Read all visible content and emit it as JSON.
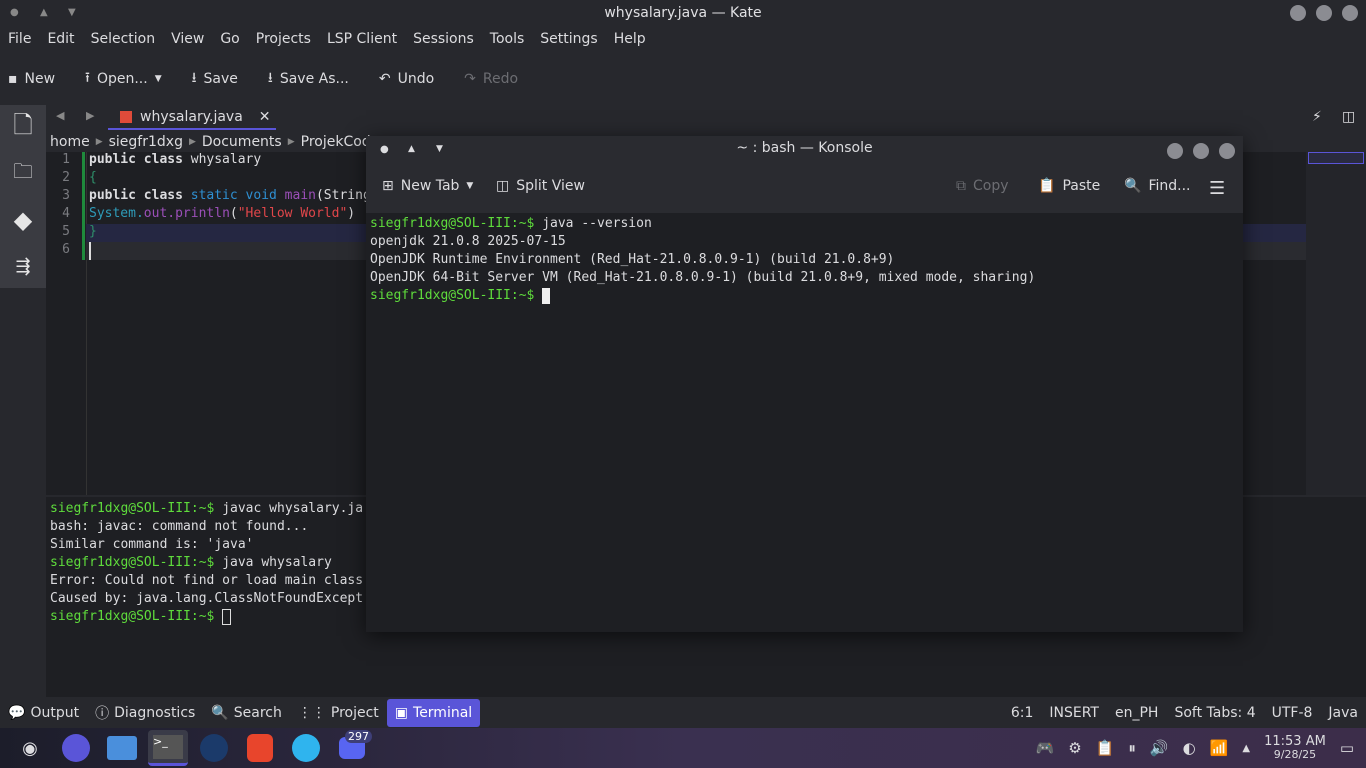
{
  "window": {
    "title": "whysalary.java — Kate"
  },
  "menu": [
    "File",
    "Edit",
    "Selection",
    "View",
    "Go",
    "Projects",
    "LSP Client",
    "Sessions",
    "Tools",
    "Settings",
    "Help"
  ],
  "toolbar": {
    "new": "New",
    "open": "Open...",
    "save": "Save",
    "save_as": "Save As...",
    "undo": "Undo",
    "redo": "Redo"
  },
  "tab": {
    "label": "whysalary.java"
  },
  "breadcrumb": [
    "home",
    "siegfr1dxg",
    "Documents",
    "ProjekCods"
  ],
  "code": {
    "lines": [
      "1",
      "2",
      "3",
      "4",
      "5",
      "6"
    ],
    "l1a": "public class",
    "l1b": " whysalary",
    "l2": "{",
    "l3a": "public class",
    "l3b": " static void ",
    "l3c": "main",
    "l3d": "(String",
    "l4a": "System.",
    "l4b": "out.println",
    "l4c": "(",
    "l4d": "\"Hellow World\"",
    "l4e": ")",
    "l5": "}"
  },
  "bottom_terminal": [
    {
      "prompt": "siegfr1dxg@SOL-III:~$",
      "text": " javac whysalary.ja"
    },
    {
      "text": "bash: javac: command not found..."
    },
    {
      "text": "Similar command is: 'java'"
    },
    {
      "prompt": "siegfr1dxg@SOL-III:~$",
      "text": " java whysalary"
    },
    {
      "text": "Error: Could not find or load main class"
    },
    {
      "text": "Caused by: java.lang.ClassNotFoundExcept"
    },
    {
      "prompt": "siegfr1dxg@SOL-III:~$",
      "text": " "
    }
  ],
  "konsole": {
    "title": "~ : bash — Konsole",
    "new_tab": "New Tab",
    "split_view": "Split View",
    "copy": "Copy",
    "paste": "Paste",
    "find": "Find...",
    "lines": [
      {
        "prompt": "siegfr1dxg@SOL-III:~$",
        "text": " java --version"
      },
      {
        "text": "openjdk 21.0.8 2025-07-15"
      },
      {
        "text": "OpenJDK Runtime Environment (Red_Hat-21.0.8.0.9-1) (build 21.0.8+9)"
      },
      {
        "text": "OpenJDK 64-Bit Server VM (Red_Hat-21.0.8.0.9-1) (build 21.0.8+9, mixed mode, sharing)"
      },
      {
        "prompt": "siegfr1dxg@SOL-III:~$",
        "text": " "
      }
    ]
  },
  "statusbar": {
    "output": "Output",
    "diagnostics": "Diagnostics",
    "search": "Search",
    "project": "Project",
    "terminal": "Terminal",
    "cursor": "6:1",
    "mode": "INSERT",
    "lang_dict": "en_PH",
    "indent": "Soft Tabs: 4",
    "encoding": "UTF-8",
    "syntax": "Java"
  },
  "taskbar": {
    "discord_badge": "297",
    "time": "11:53 AM",
    "date": "9/28/25"
  },
  "colors": {
    "accent": "#5a55d8",
    "prompt": "#5fdc3c",
    "keyword_blue": "#2e8fd1",
    "purple": "#9b4fb8",
    "string": "#e0464a"
  }
}
